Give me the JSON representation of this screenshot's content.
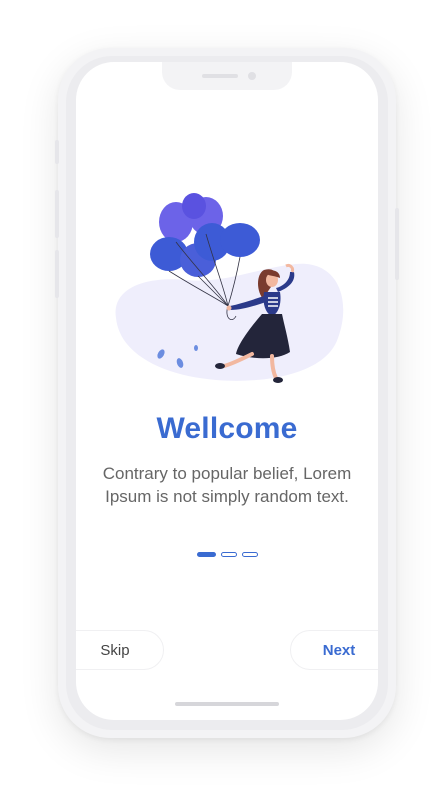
{
  "onboarding": {
    "title": "Wellcome",
    "description": "Contrary to popular belief, Lorem Ipsum is not simply random text.",
    "page_indicator": {
      "total": 3,
      "active_index": 0
    },
    "skip_label": "Skip",
    "next_label": "Next"
  },
  "illustration": {
    "icon": "woman-with-balloons-illustration"
  },
  "colors": {
    "accent": "#3a6bd1",
    "balloon_purple": "#6c63e8",
    "balloon_blue": "#3d5bd6",
    "blob_background": "#efeefc",
    "text_secondary": "#666666"
  }
}
